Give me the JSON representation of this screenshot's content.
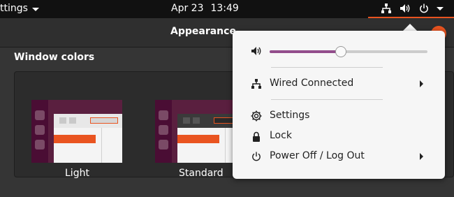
{
  "topbar": {
    "app_menu_label": "ttings",
    "date": "Apr 23",
    "time": "13:49",
    "icons": [
      "network-wired-icon",
      "volume-icon",
      "power-icon",
      "menu-caret-icon"
    ]
  },
  "window": {
    "title": "Appearance",
    "section_title": "Window colors",
    "themes": [
      {
        "label": "Light"
      },
      {
        "label": "Standard"
      }
    ]
  },
  "menu": {
    "volume": {
      "icon": "volume-icon",
      "level": 0.45
    },
    "network": {
      "icon": "network-wired-icon",
      "label": "Wired Connected"
    },
    "settings": {
      "icon": "gear-icon",
      "label": "Settings"
    },
    "lock": {
      "icon": "lock-icon",
      "label": "Lock"
    },
    "power": {
      "icon": "power-icon",
      "label": "Power Off / Log Out"
    }
  },
  "colors": {
    "accent": "#e95420",
    "slider_fill": "#924d8b",
    "menu_bg": "#f6f6f6",
    "topbar_bg": "#111111"
  }
}
